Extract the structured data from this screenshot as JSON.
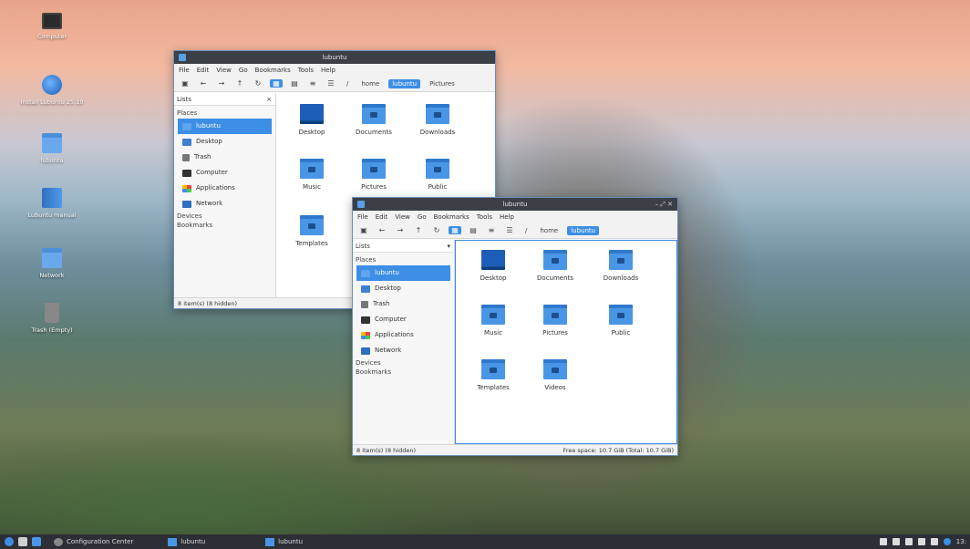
{
  "desktop_icons": [
    {
      "label": "Computer",
      "icon": "monitor-icon"
    },
    {
      "label": "Install Lubuntu 25.10",
      "icon": "installer-globe-icon"
    },
    {
      "label": "lubuntu",
      "icon": "home-folder-icon"
    },
    {
      "label": "Lubuntu manual",
      "icon": "manual-icon"
    },
    {
      "label": "Network",
      "icon": "network-folder-icon"
    },
    {
      "label": "Trash (Empty)",
      "icon": "trash-icon"
    }
  ],
  "menu": [
    "File",
    "Edit",
    "View",
    "Go",
    "Bookmarks",
    "Tools",
    "Help"
  ],
  "path": [
    "/",
    "home",
    "lubuntu"
  ],
  "window_back": {
    "title": "lubuntu",
    "extra_crumb": "Pictures",
    "side_header": "Lists",
    "places_label": "Places",
    "places": [
      "lubuntu",
      "Desktop",
      "Trash",
      "Computer",
      "Applications",
      "Network"
    ],
    "devices_label": "Devices",
    "bookmarks_label": "Bookmarks",
    "files": [
      "Desktop",
      "Documents",
      "Downloads",
      "Music",
      "Pictures",
      "Public",
      "Templates"
    ],
    "status_left": "8 item(s) (8 hidden)"
  },
  "window_front": {
    "title": "lubuntu",
    "controls": "–  ⤢  ✕",
    "side_header": "Lists",
    "places_label": "Places",
    "places": [
      "lubuntu",
      "Desktop",
      "Trash",
      "Computer",
      "Applications",
      "Network"
    ],
    "devices_label": "Devices",
    "bookmarks_label": "Bookmarks",
    "files": [
      "Desktop",
      "Documents",
      "Downloads",
      "Music",
      "Pictures",
      "Public",
      "Templates",
      "Videos"
    ],
    "status_left": "8 item(s) (8 hidden)",
    "status_right": "Free space: 10.7 GiB (Total: 10.7 GiB)"
  },
  "taskbar": {
    "tasks": [
      "Configuration Center",
      "lubuntu",
      "lubuntu"
    ],
    "clock": "13:"
  },
  "colors": {
    "accent": "#3d8ee5",
    "titlebar": "#3b3f46",
    "taskbar": "#2c2f35"
  }
}
